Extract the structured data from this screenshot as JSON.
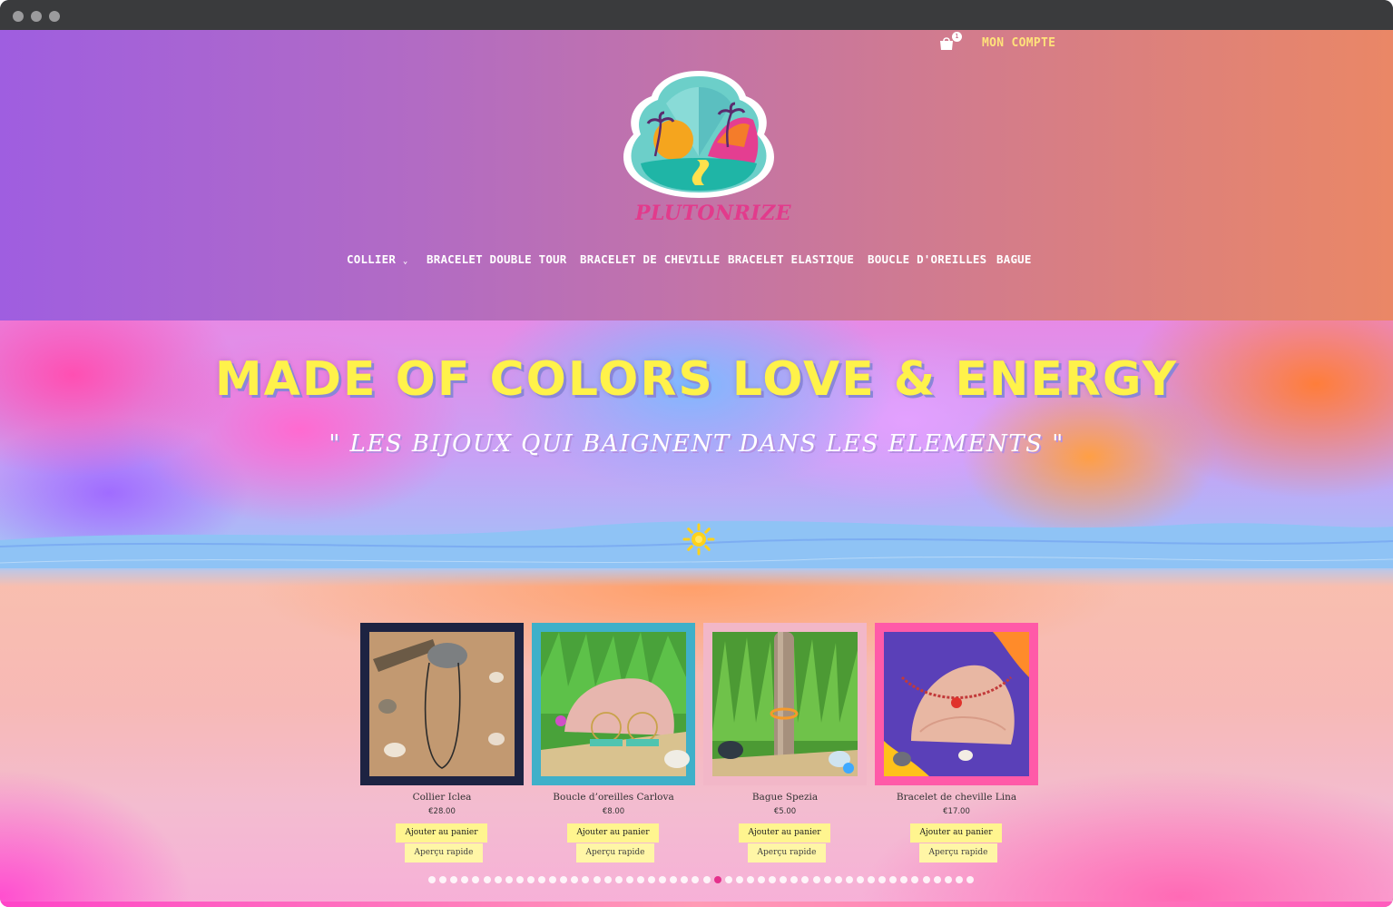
{
  "header": {
    "cart_count": "1",
    "account_label": "MON COMPTE",
    "logo_text": "PLUTONRIZE",
    "cart_icon": "shopping-bag-icon"
  },
  "nav": {
    "items": [
      {
        "label": "COLLIER",
        "has_dropdown": true
      },
      {
        "label": "BRACELET DOUBLE TOUR"
      },
      {
        "label": "BRACELET DE CHEVILLE"
      },
      {
        "label": "BRACELET ELASTIQUE"
      },
      {
        "label": "BOUCLE D'OREILLES"
      },
      {
        "label": "BAGUE"
      }
    ]
  },
  "hero": {
    "title": "MADE OF COLORS LOVE & ENERGY",
    "subtitle": "\" LES BIJOUX QUI BAIGNENT DANS LES ELEMENTS \"",
    "icon": "sun-icon"
  },
  "products": [
    {
      "name": "Collier Iclea",
      "price": "€28.00",
      "add_label": "Ajouter au panier",
      "quick_label": "Aperçu rapide"
    },
    {
      "name": "Boucle d’oreilles Carlova",
      "price": "€8.00",
      "add_label": "Ajouter au panier",
      "quick_label": "Aperçu rapide"
    },
    {
      "name": "Bague Spezia",
      "price": "€5.00",
      "add_label": "Ajouter au panier",
      "quick_label": "Aperçu rapide"
    },
    {
      "name": "Bracelet de cheville Lina",
      "price": "€17.00",
      "add_label": "Ajouter au panier",
      "quick_label": "Aperçu rapide"
    }
  ],
  "pagination": {
    "total": 50,
    "active_index": 26
  },
  "colors": {
    "accent_yellow": "#fff24a",
    "button_bg": "#fff58f",
    "active_dot": "#e5318c",
    "logo_pink": "#e23b8c"
  }
}
